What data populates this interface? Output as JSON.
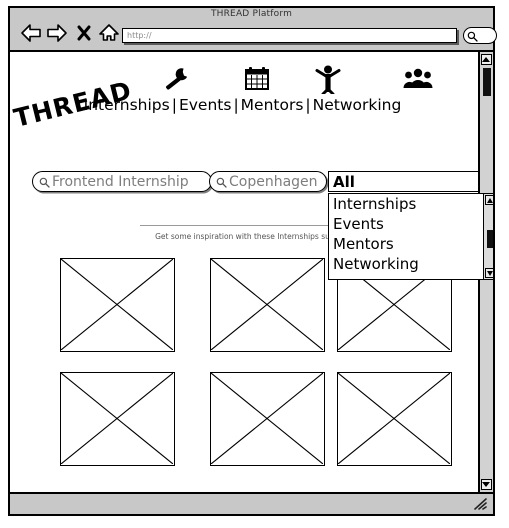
{
  "window": {
    "title": "THREAD Platform",
    "toolbar": {
      "back_icon": "back-arrow-icon",
      "forward_icon": "forward-arrow-icon",
      "stop_icon": "close-x-icon",
      "home_icon": "home-icon",
      "url_value": "http://",
      "search_icon": "search-icon"
    },
    "statusbar": {
      "resize_grip_icon": "resize-grip-icon"
    }
  },
  "site": {
    "logo": "THREAD",
    "nav": {
      "items": [
        {
          "label": "Internships",
          "icon": "wrench-icon"
        },
        {
          "label": "Events",
          "icon": "calendar-icon"
        },
        {
          "label": "Mentors",
          "icon": "person-icon"
        },
        {
          "label": "Networking",
          "icon": "group-people-icon"
        }
      ],
      "separator": "|"
    }
  },
  "search": {
    "role_placeholder": "Frontend Internship",
    "location_placeholder": "Copenhagen",
    "icon": "search-icon",
    "category": {
      "selected": "All",
      "caret_icon": "chevron-down-icon",
      "expanded": true,
      "options": [
        "Internships",
        "Events",
        "Mentors",
        "Networking"
      ],
      "scroll_up_icon": "scroll-up-arrow-icon",
      "scroll_down_icon": "scroll-down-arrow-icon"
    }
  },
  "results": {
    "caption": "Get some inspiration with these Internships su",
    "placeholders": [
      {
        "name": "image-placeholder-1"
      },
      {
        "name": "image-placeholder-2"
      },
      {
        "name": "image-placeholder-3"
      },
      {
        "name": "image-placeholder-4"
      },
      {
        "name": "image-placeholder-5"
      },
      {
        "name": "image-placeholder-6"
      }
    ]
  }
}
